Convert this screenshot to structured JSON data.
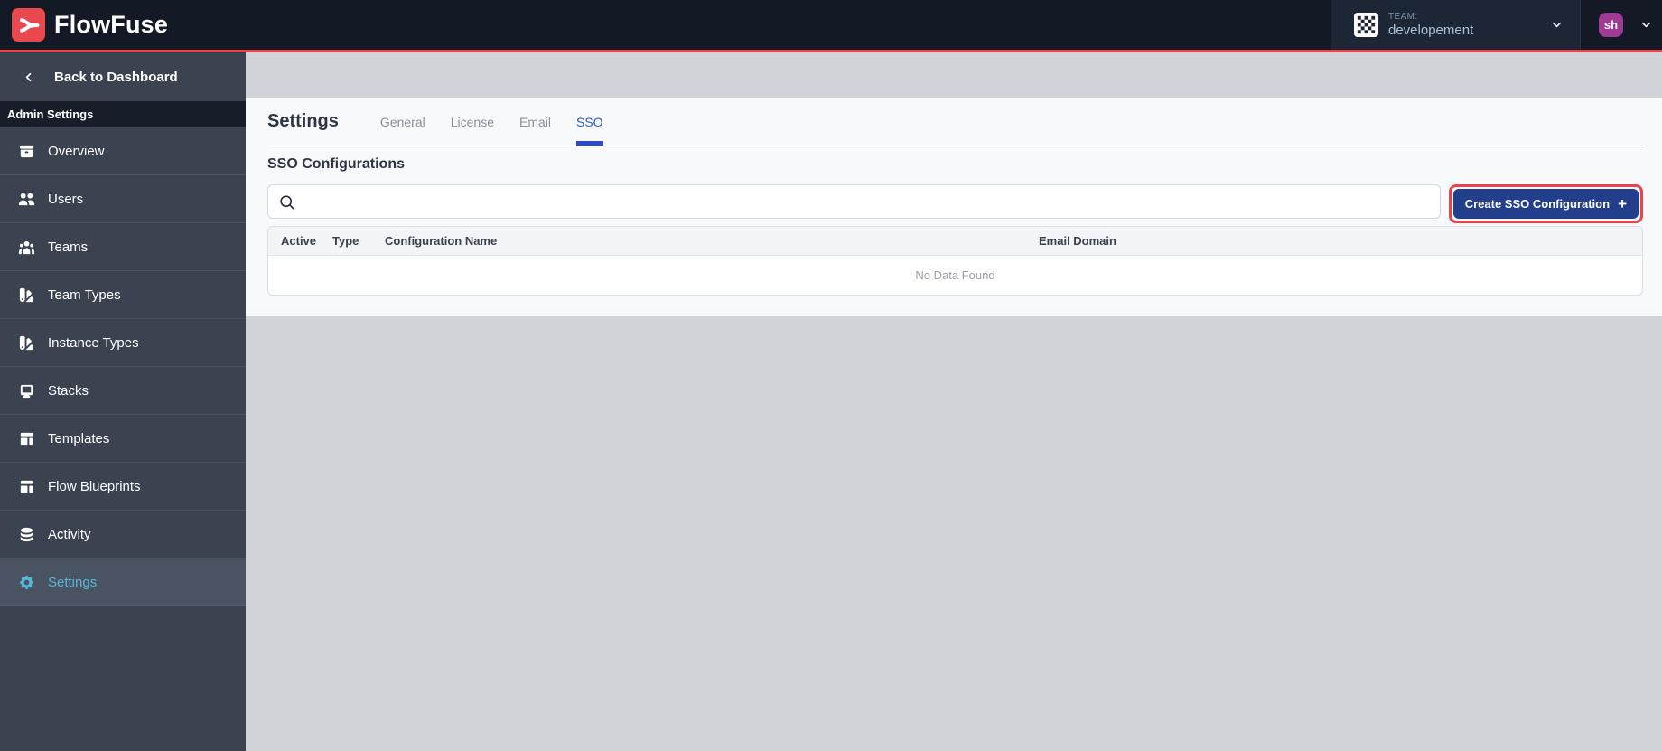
{
  "header": {
    "brand": "FlowFuse",
    "team_label": "TEAM:",
    "team_name": "developement",
    "avatar_initials": "sh"
  },
  "sidebar": {
    "back_label": "Back to Dashboard",
    "section_label": "Admin Settings",
    "items": [
      {
        "label": "Overview",
        "icon": "overview-icon",
        "active": false
      },
      {
        "label": "Users",
        "icon": "users-icon",
        "active": false
      },
      {
        "label": "Teams",
        "icon": "user-group-icon",
        "active": false
      },
      {
        "label": "Team Types",
        "icon": "color-swatch-icon",
        "active": false
      },
      {
        "label": "Instance Types",
        "icon": "color-swatch-icon",
        "active": false
      },
      {
        "label": "Stacks",
        "icon": "desktop-computer-icon",
        "active": false
      },
      {
        "label": "Templates",
        "icon": "template-icon",
        "active": false
      },
      {
        "label": "Flow Blueprints",
        "icon": "template-icon",
        "active": false
      },
      {
        "label": "Activity",
        "icon": "database-icon",
        "active": false
      },
      {
        "label": "Settings",
        "icon": "cog-icon",
        "active": true
      }
    ]
  },
  "main": {
    "page_title": "Settings",
    "tabs": [
      {
        "label": "General",
        "active": false
      },
      {
        "label": "License",
        "active": false
      },
      {
        "label": "Email",
        "active": false
      },
      {
        "label": "SSO",
        "active": true
      }
    ],
    "section_title": "SSO Configurations",
    "search_placeholder": "",
    "search_value": "",
    "create_button_label": "Create SSO Configuration",
    "create_button_icon": "plus-icon",
    "table": {
      "columns": [
        "Active",
        "Type",
        "Configuration Name",
        "Email Domain"
      ],
      "rows": [],
      "empty_text": "No Data Found"
    }
  },
  "colors": {
    "accent_red": "#e5454b",
    "brand_red": "#e8484e",
    "header_bg": "#131a25",
    "team_panel_bg": "#1d2634",
    "sidebar_bg": "#3b4351",
    "sidebar_active_bg": "#4a5361",
    "sidebar_section_bg": "#171e2a",
    "settings_blue": "#58b7d8",
    "primary_button_bg": "#233f8c",
    "tab_active_blue": "#2d5cc5",
    "tab_underline_blue": "#2c49c7",
    "avatar_purple": "#a03a94",
    "content_bg": "#f8f9fb",
    "page_bg": "#d1d3d9"
  }
}
